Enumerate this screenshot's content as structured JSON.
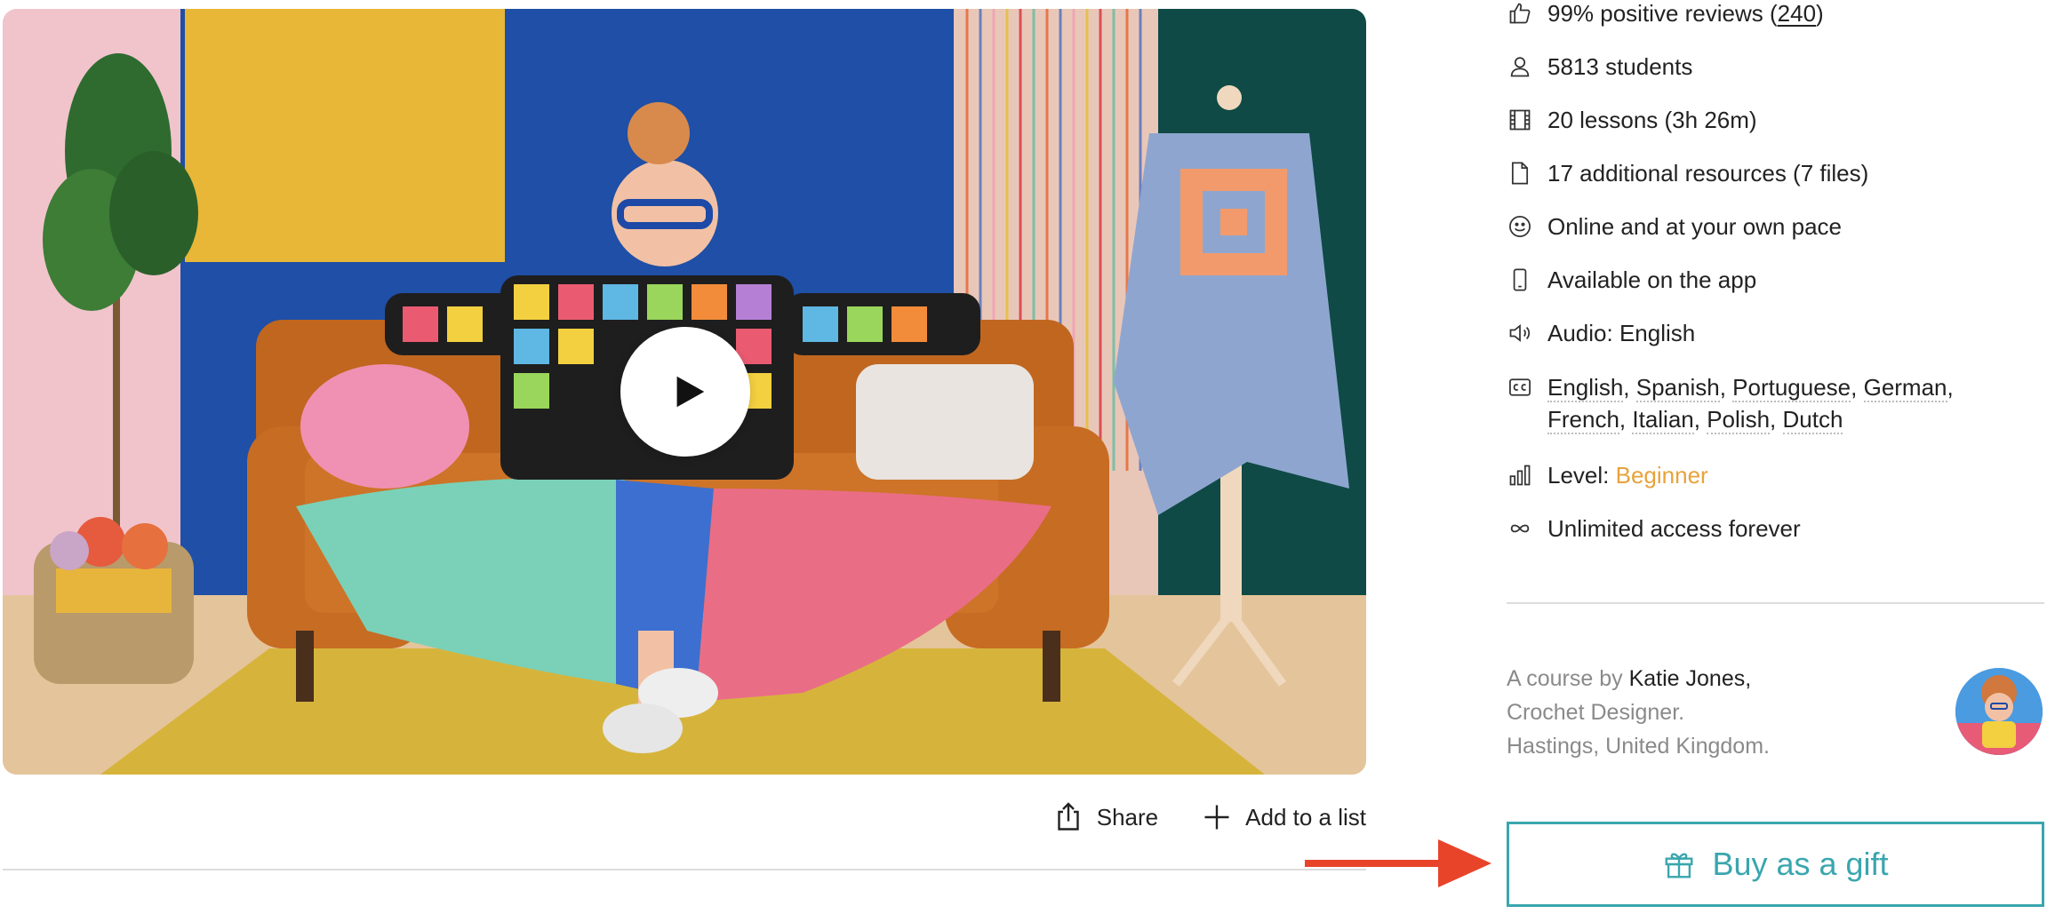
{
  "video": {
    "play_icon": "play-icon"
  },
  "actions": {
    "share_label": "Share",
    "add_list_label": "Add to a list"
  },
  "features": {
    "reviews": {
      "text": "99% positive reviews (",
      "count": "240",
      "close": ")",
      "icon": "thumbs-up-icon"
    },
    "students": {
      "text": "5813 students",
      "icon": "user-icon"
    },
    "lessons": {
      "text": "20 lessons (3h 26m)",
      "icon": "film-icon"
    },
    "resources": {
      "text": "17 additional resources (7 files)",
      "icon": "file-icon"
    },
    "pace": {
      "text": "Online and at your own pace",
      "icon": "smile-icon"
    },
    "app": {
      "text": "Available on the app",
      "icon": "phone-icon"
    },
    "audio": {
      "text": "Audio: English",
      "icon": "speaker-icon"
    },
    "subtitles": {
      "icon": "cc-icon",
      "languages": [
        "English",
        "Spanish",
        "Portuguese",
        "German",
        "French",
        "Italian",
        "Polish",
        "Dutch"
      ]
    },
    "level": {
      "label": "Level: ",
      "value": "Beginner",
      "icon": "bar-chart-icon"
    },
    "access": {
      "text": "Unlimited access forever",
      "icon": "infinity-icon"
    }
  },
  "author": {
    "prefix": "A course by ",
    "name": "Katie Jones,",
    "role": "Crochet Designer.",
    "location": "Hastings, United Kingdom."
  },
  "gift": {
    "label": "Buy as a gift",
    "icon": "gift-icon"
  },
  "colors": {
    "accent": "#3aa6ae",
    "level": "#e8a23a",
    "arrow": "#e8442a"
  }
}
